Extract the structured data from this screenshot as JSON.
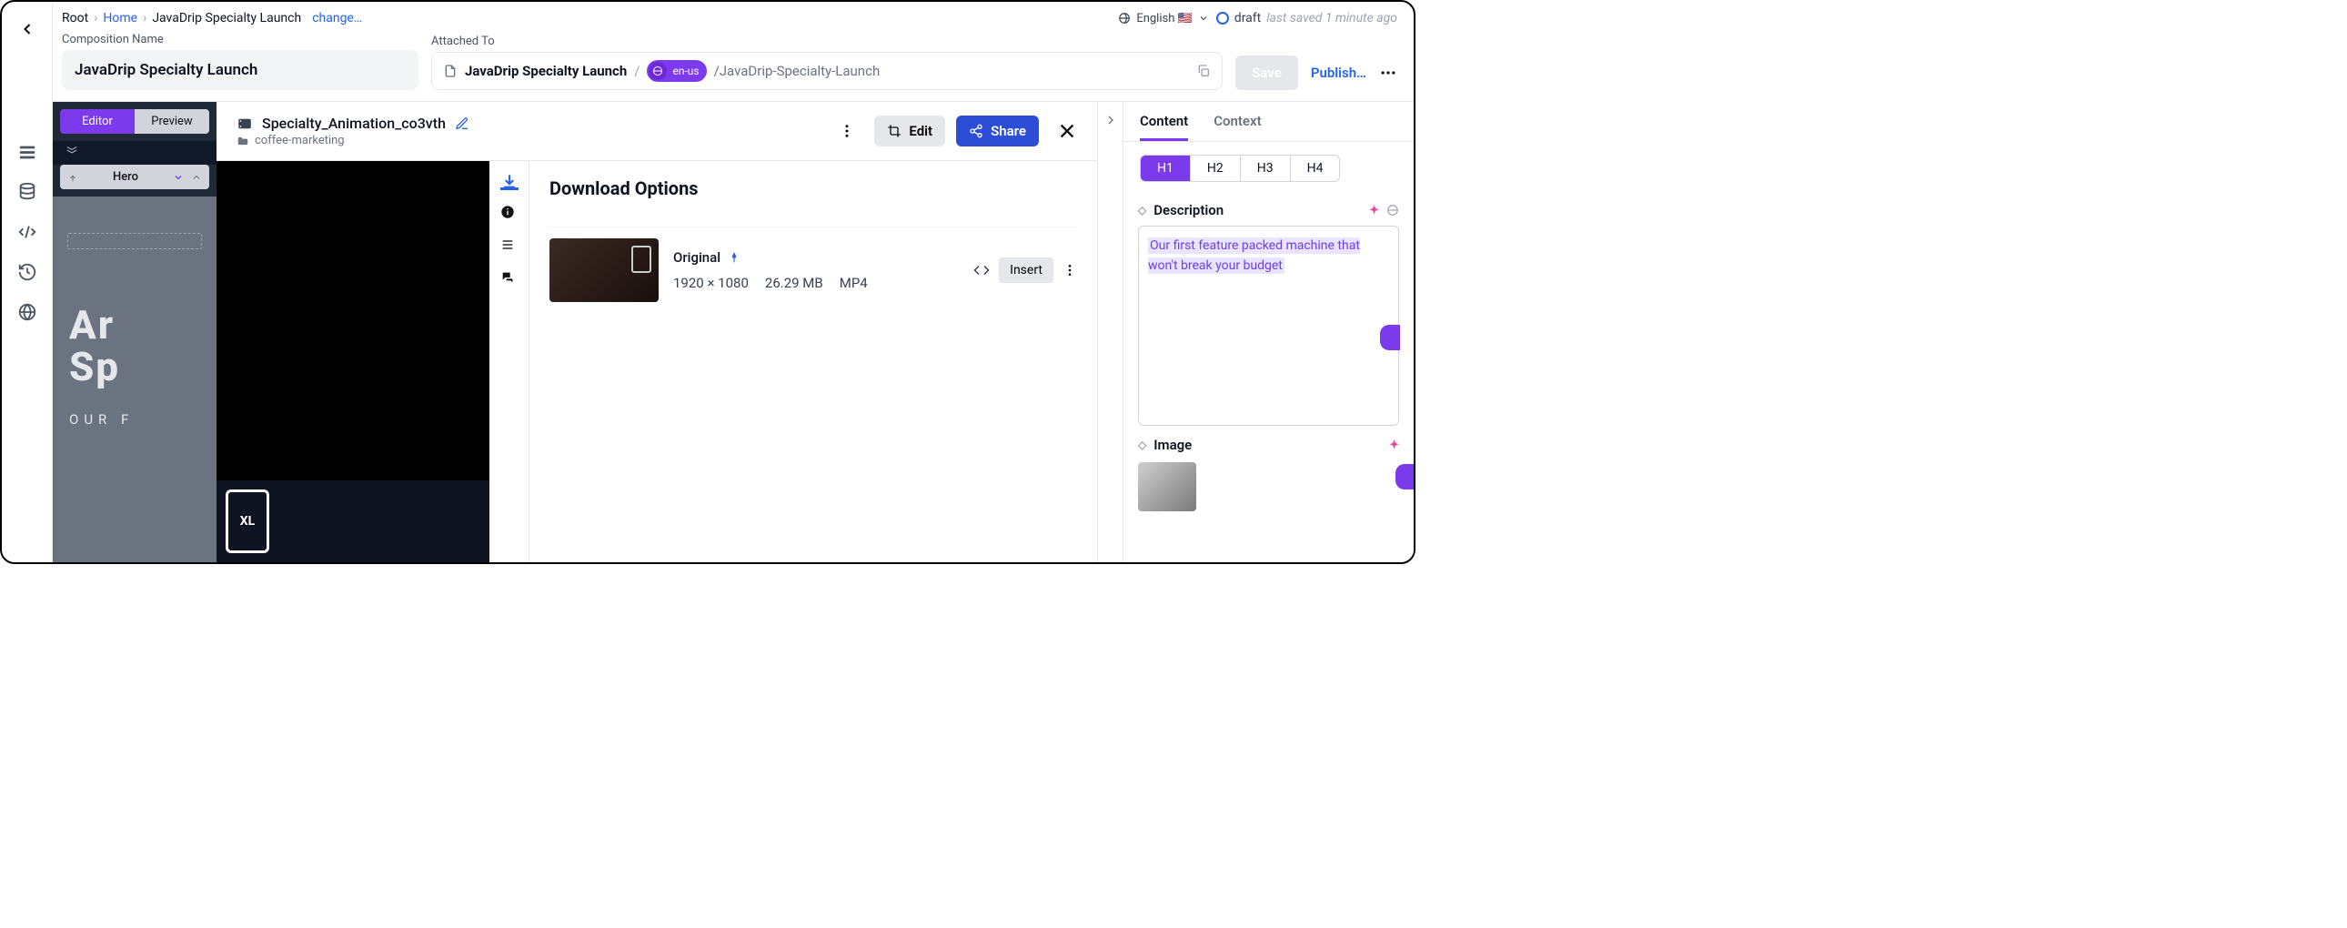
{
  "breadcrumbs": {
    "root": "Root",
    "home": "Home",
    "current": "JavaDrip Specialty Launch",
    "change": "change…"
  },
  "locale": {
    "label": "English 🇺🇸"
  },
  "status": {
    "state": "draft",
    "saved": "last saved 1 minute ago"
  },
  "fields": {
    "compositionNameLabel": "Composition Name",
    "compositionName": "JavaDrip Specialty Launch",
    "attachedToLabel": "Attached To",
    "attachedDoc": "JavaDrip Specialty Launch",
    "attachedLocale": "en-us",
    "attachedSlug": "/JavaDrip-Specialty-Launch"
  },
  "actions": {
    "save": "Save",
    "publish": "Publish…"
  },
  "modeTabs": {
    "editor": "Editor",
    "preview": "Preview"
  },
  "componentSelector": {
    "value": "Hero"
  },
  "canvas": {
    "headline1": "Ar",
    "headline2": "Sp",
    "subline": "OUR  F"
  },
  "asset": {
    "title": "Specialty_Animation_co3vth",
    "folder": "coffee-marketing",
    "edit": "Edit",
    "share": "Share",
    "downloadTitle": "Download Options",
    "variant": {
      "name": "Original",
      "dims": "1920 × 1080",
      "size": "26.29 MB",
      "format": "MP4",
      "insert": "Insert"
    }
  },
  "videoOverlay": {
    "label": "XL"
  },
  "propTabs": {
    "content": "Content",
    "context": "Context"
  },
  "headingLevels": [
    "H1",
    "H2",
    "H3",
    "H4"
  ],
  "descLabel": "Description",
  "descText": "Our first feature packed machine that won't break your budget",
  "imageLabel": "Image"
}
